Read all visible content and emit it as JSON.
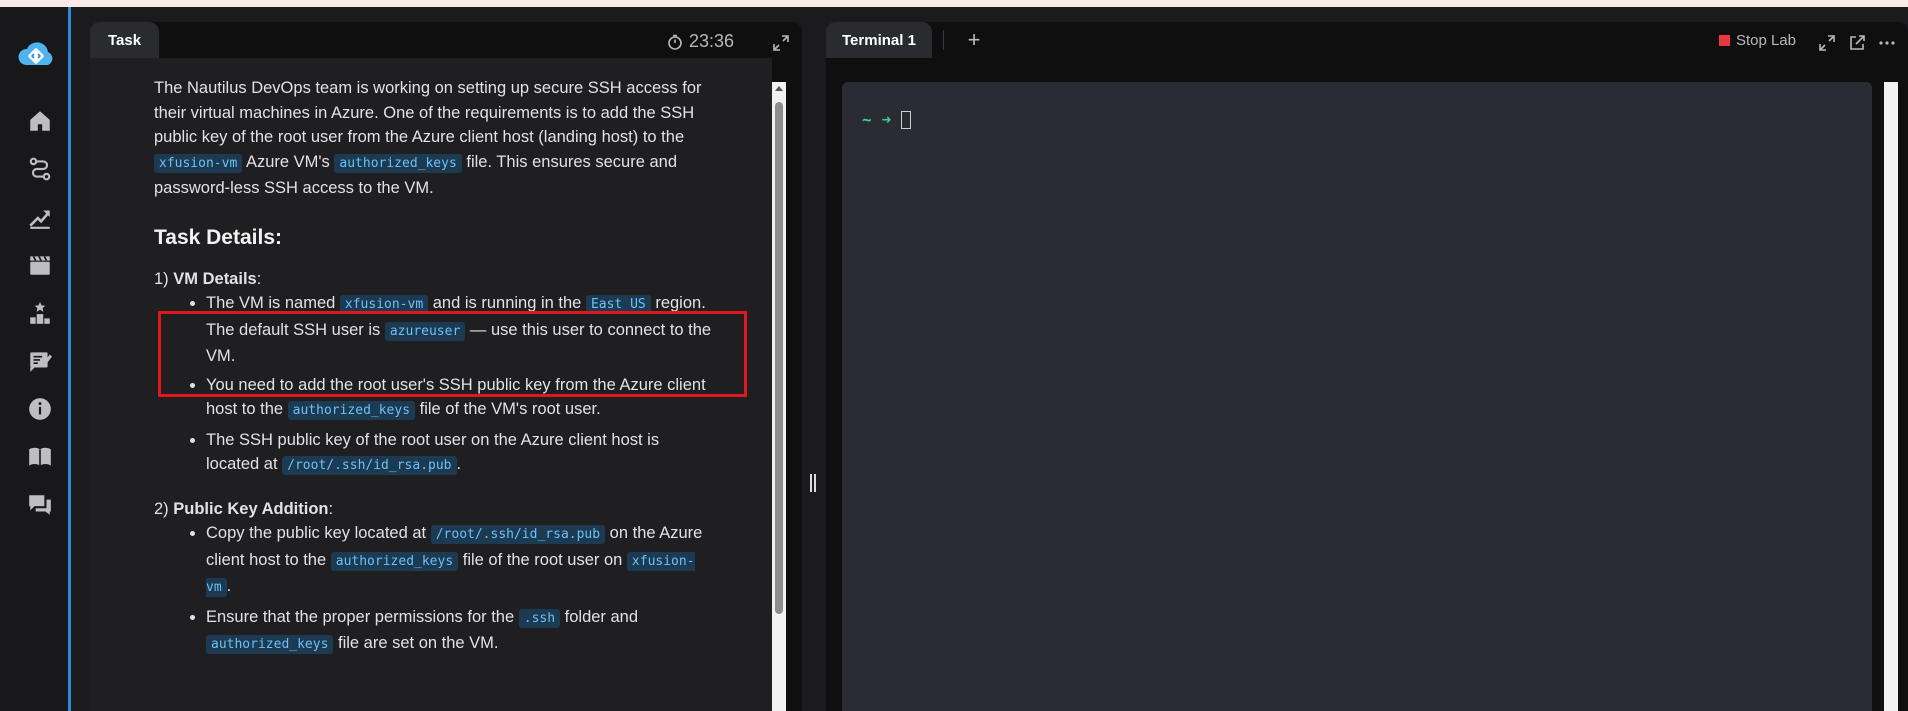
{
  "sidebar": {
    "logo_icon": "kodekloud-cloud-logo",
    "items": [
      {
        "icon": "home-icon"
      },
      {
        "icon": "route-icon"
      },
      {
        "icon": "growth-chart-icon"
      },
      {
        "icon": "clapperboard-icon"
      },
      {
        "icon": "leaderboard-icon"
      },
      {
        "icon": "notes-edit-icon"
      },
      {
        "icon": "info-icon"
      },
      {
        "icon": "book-icon"
      },
      {
        "icon": "chat-icon"
      }
    ]
  },
  "task_panel": {
    "tab_label": "Task",
    "timer": "23:36",
    "intro": {
      "t1": "The Nautilus DevOps team is working on setting up secure SSH access for their virtual machines in Azure. One of the requirements is to add the SSH public key of the root user from the Azure client host (landing host) to the ",
      "c1": "xfusion-vm",
      "t2": " Azure VM's ",
      "c2": "authorized_keys",
      "t3": " file. This ensures secure and password-less SSH access to the VM."
    },
    "heading": "Task Details:",
    "section1": {
      "number": "1) ",
      "title": "VM Details",
      "colon": ":",
      "bullets": [
        {
          "t1": "The VM is named ",
          "c1": "xfusion-vm",
          "t2": " and is running in the ",
          "c2": "East US",
          "t3": " region. The default SSH user is ",
          "c3": "azureuser",
          "t4": " — use this user to connect to the VM."
        },
        {
          "t1": "You need to add the root user's SSH public key from the Azure client host to the ",
          "c1": "authorized_keys",
          "t2": " file of the VM's root user."
        },
        {
          "t1": "The SSH public key of the root user on the Azure client host is located at ",
          "c1": "/root/.ssh/id_rsa.pub",
          "t2": "."
        }
      ]
    },
    "section2": {
      "number": "2) ",
      "title": "Public Key Addition",
      "colon": ":",
      "bullets": [
        {
          "t1": "Copy the public key located at ",
          "c1": "/root/.ssh/id_rsa.pub",
          "t2": " on the Azure client host to the ",
          "c2": "authorized_keys",
          "t3": " file of the root user on ",
          "c3": "xfusion-vm",
          "t4": "."
        },
        {
          "t1": "Ensure that the proper permissions for the ",
          "c1": ".ssh",
          "t2": " folder and ",
          "c2": "authorized_keys",
          "t3": " file are set on the VM."
        }
      ]
    }
  },
  "terminal_panel": {
    "tab_label": "Terminal 1",
    "add_tab": "+",
    "stop_lab": "Stop Lab",
    "prompt_tilde": "~",
    "prompt_arrow": "➜"
  },
  "colors": {
    "accent": "#2b8bd8",
    "code_bg": "#1c3a52",
    "code_text": "#6cc0f5",
    "highlight_box": "#e0171f",
    "prompt_green": "#34d399",
    "stop_red": "#e8373e"
  }
}
